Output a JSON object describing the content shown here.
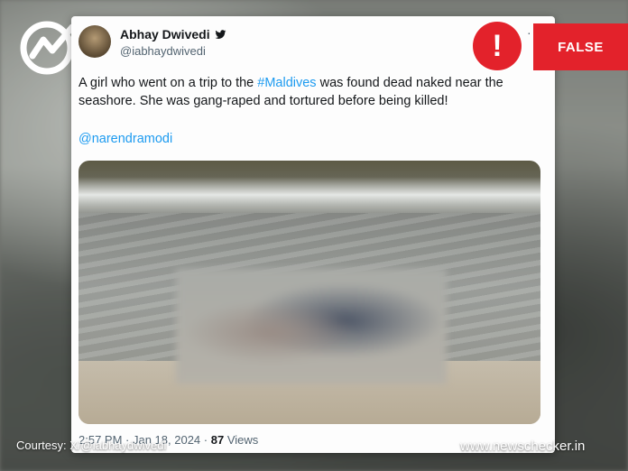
{
  "tweet": {
    "author_name": "Abhay Dwivedi",
    "handle": "@iabhaydwivedi",
    "text_part1": "A girl who went on a trip  to the ",
    "hashtag": "#Maldives",
    "text_part2": " was found dead naked near the seashore. She was gang-raped and tortured before being killed!",
    "mention": "@narendramodi",
    "time": "2:57 PM",
    "date": "Jan 18, 2024",
    "views_count": "87",
    "views_label": "Views",
    "more_menu": "···"
  },
  "verdict": {
    "label": "FALSE",
    "alert_glyph": "!",
    "color": "#e3222b"
  },
  "footer": {
    "courtesy": "Courtesy: X/@iabhaydwivedi",
    "site": "www.newschecker.in"
  },
  "colors": {
    "link": "#1d9bf0",
    "text": "#14171a",
    "muted": "#536471"
  }
}
